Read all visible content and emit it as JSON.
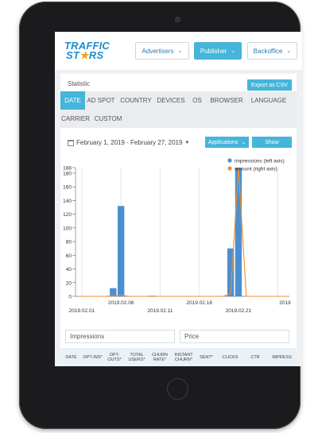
{
  "brand": {
    "line1": "TRAFFIC",
    "line2_a": "ST",
    "line2_b": "RS"
  },
  "nav": [
    {
      "label": "Advertisers",
      "active": false
    },
    {
      "label": "Publisher",
      "active": true
    },
    {
      "label": "Backoffice",
      "active": false
    }
  ],
  "statistic": {
    "title": "Statistic",
    "export_label": "Export as CSV"
  },
  "tabs": [
    "DATE",
    "AD SPOT",
    "COUNTRY",
    "DEVICES",
    "OS",
    "BROWSER",
    "LANGUAGE",
    "CARRIER",
    "CUSTOM"
  ],
  "filters": {
    "date_range": "February 1, 2019 - February 27, 2019",
    "applications_label": "Applications",
    "show_label": "Show"
  },
  "chart_data": {
    "type": "bar",
    "left_axis_ticks": [
      "0",
      "20",
      "40",
      "60",
      "80",
      "100",
      "120",
      "140",
      "160",
      "180",
      "188"
    ],
    "x_tick_labels_bottom": [
      "2019.02.01",
      "2019.02.11",
      "2019.02.21"
    ],
    "x_tick_labels_top": [
      "2019.02.06",
      "2019.02.16",
      "2019"
    ],
    "ylim": [
      0,
      188
    ],
    "series": [
      {
        "name": "impressions (left axis)",
        "color": "#4a90cf",
        "values": [
          {
            "x": "2019.02.05",
            "y": 12
          },
          {
            "x": "2019.02.06",
            "y": 132
          },
          {
            "x": "2019.02.10",
            "y": 1
          },
          {
            "x": "2019.02.20",
            "y": 70
          },
          {
            "x": "2019.02.21",
            "y": 188
          }
        ]
      },
      {
        "name": "amount (right axis)",
        "color": "#f28e2b",
        "values": [
          {
            "x": "2019.02.05",
            "y": 1
          },
          {
            "x": "2019.02.06",
            "y": 2
          },
          {
            "x": "2019.02.20",
            "y": 4
          },
          {
            "x": "2019.02.21",
            "y": 188
          }
        ]
      }
    ]
  },
  "metrics": {
    "left": "Impressions",
    "right": "Price"
  },
  "table_headers": [
    "DATE",
    "OPT-INS*",
    "OPT-OUTS*",
    "TOTAL USERS*",
    "CHURN RATE*",
    "INSTANT CHURN*",
    "SENT*",
    "CLICKS",
    "CTR",
    "IMPRESS"
  ]
}
